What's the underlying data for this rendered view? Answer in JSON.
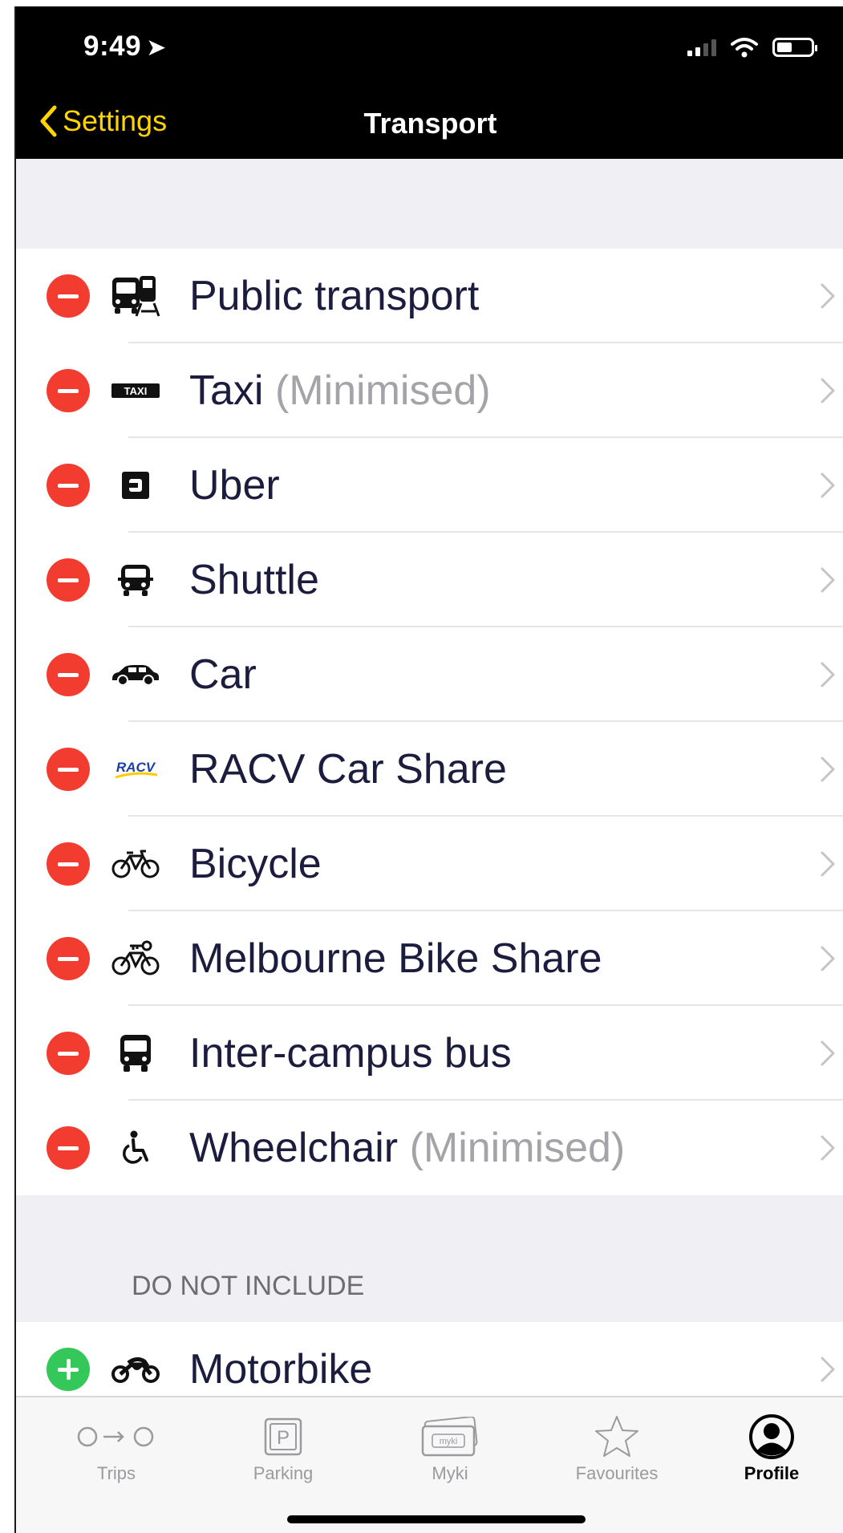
{
  "status_bar": {
    "time": "9:49",
    "location_glyph": "➤"
  },
  "nav": {
    "back_label": "Settings",
    "title": "Transport"
  },
  "included": [
    {
      "label": "Public transport",
      "note": "",
      "icon": "public-transport-icon"
    },
    {
      "label": "Taxi",
      "note": "(Minimised)",
      "icon": "taxi-icon"
    },
    {
      "label": "Uber",
      "note": "",
      "icon": "uber-icon"
    },
    {
      "label": "Shuttle",
      "note": "",
      "icon": "shuttle-icon"
    },
    {
      "label": "Car",
      "note": "",
      "icon": "car-icon"
    },
    {
      "label": "RACV Car Share",
      "note": "",
      "icon": "racv-icon"
    },
    {
      "label": "Bicycle",
      "note": "",
      "icon": "bicycle-icon"
    },
    {
      "label": "Melbourne Bike Share",
      "note": "",
      "icon": "bike-share-icon"
    },
    {
      "label": "Inter-campus bus",
      "note": "",
      "icon": "bus-icon"
    },
    {
      "label": "Wheelchair",
      "note": "(Minimised)",
      "icon": "wheelchair-icon"
    }
  ],
  "excluded_header": "DO NOT INCLUDE",
  "excluded": [
    {
      "label": "Motorbike",
      "note": "",
      "icon": "motorbike-icon"
    }
  ],
  "icon_text": {
    "taxi": "TAXI",
    "racv": "RACV",
    "myki": "myki",
    "parking": "P"
  },
  "tabs": [
    {
      "label": "Trips",
      "icon": "trips-icon",
      "active": false
    },
    {
      "label": "Parking",
      "icon": "parking-icon",
      "active": false
    },
    {
      "label": "Myki",
      "icon": "myki-icon",
      "active": false
    },
    {
      "label": "Favourites",
      "icon": "star-icon",
      "active": false
    },
    {
      "label": "Profile",
      "icon": "profile-icon",
      "active": true
    }
  ],
  "colors": {
    "accent": "#ffd400",
    "remove": "#f23c30",
    "add": "#34c759",
    "text": "#1c1d3e",
    "muted": "#a3a3a8"
  }
}
